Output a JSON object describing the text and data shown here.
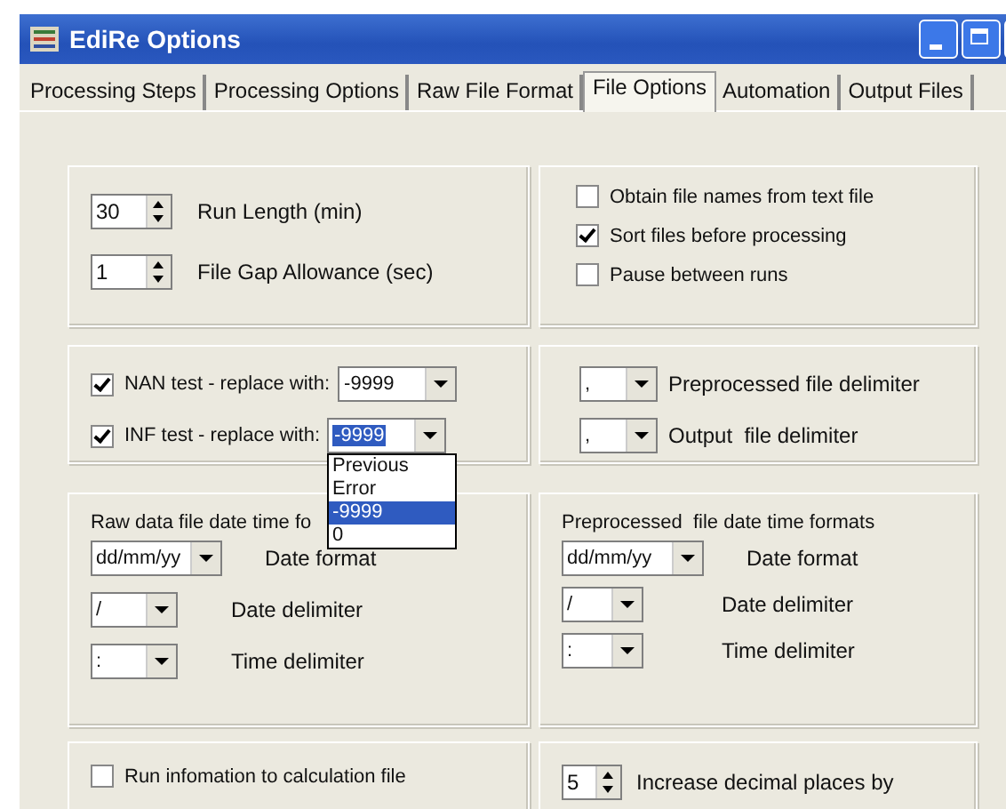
{
  "window": {
    "title": "EdiRe Options"
  },
  "tabs": [
    {
      "label": "Processing Steps",
      "selected": false
    },
    {
      "label": "Processing Options",
      "selected": false
    },
    {
      "label": "Raw File Format",
      "selected": false
    },
    {
      "label": "File Options",
      "selected": true
    },
    {
      "label": "Automation",
      "selected": false
    },
    {
      "label": "Output Files",
      "selected": false
    }
  ],
  "run_settings": [
    {
      "value": "30",
      "label": "Run Length (min)"
    },
    {
      "value": "1",
      "label": "File Gap Allowance (sec)"
    }
  ],
  "file_checks": [
    {
      "label": "Obtain file names from text file",
      "checked": false
    },
    {
      "label": "Sort files before processing",
      "checked": true
    },
    {
      "label": "Pause between runs",
      "checked": false
    }
  ],
  "replace_tests": [
    {
      "label": "NAN test - replace with:",
      "checked": true,
      "value": "-9999",
      "focused": false,
      "expanded": false
    },
    {
      "label": "INF test - replace with:",
      "checked": true,
      "value": "-9999",
      "focused": true,
      "expanded": true
    }
  ],
  "dropdown_options": [
    {
      "label": "Previous",
      "selected": false
    },
    {
      "label": "Error",
      "selected": false
    },
    {
      "label": "-9999",
      "selected": true
    },
    {
      "label": "0",
      "selected": false
    }
  ],
  "delimiters": [
    {
      "value": ",",
      "label": "Preprocessed file delimiter"
    },
    {
      "value": ",",
      "label": "Output  file delimiter"
    }
  ],
  "raw_formats": {
    "title": "Raw data file date time fo",
    "rows": [
      {
        "value": "dd/mm/yy",
        "label": "Date format",
        "kind": "wide"
      },
      {
        "value": "/",
        "label": "Date delimiter",
        "kind": "narrow"
      },
      {
        "value": ":",
        "label": "Time delimiter",
        "kind": "narrow"
      }
    ]
  },
  "preprocessed_formats": {
    "title": "Preprocessed  file date time formats",
    "rows": [
      {
        "value": "dd/mm/yy",
        "label": "Date format",
        "kind": "wide"
      },
      {
        "value": "/",
        "label": "Date delimiter",
        "kind": "narrow"
      },
      {
        "value": ":",
        "label": "Time delimiter",
        "kind": "narrow"
      }
    ]
  },
  "run_info": {
    "label": "Run infomation to calculation file",
    "checked": false
  },
  "decimal": {
    "value": "5",
    "label": "Increase decimal places by"
  }
}
